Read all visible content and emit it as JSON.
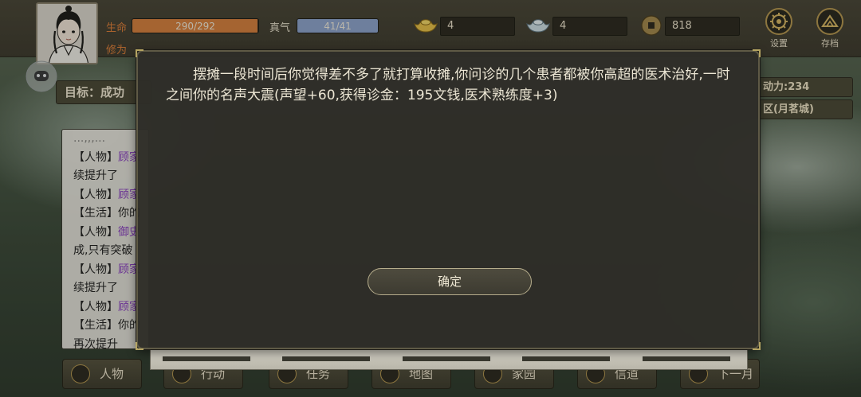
{
  "player": {
    "hp_label": "生命",
    "hp_value": "290/292",
    "hp_ratio": 0.993,
    "qi_label": "真气",
    "qi_value": "41/41",
    "qi_ratio": 1.0,
    "cultivation_label": "修为"
  },
  "currency": [
    {
      "icon": "gold-ingot-icon",
      "value": "4"
    },
    {
      "icon": "silver-ingot-icon",
      "value": "4"
    },
    {
      "icon": "copper-coin-icon",
      "value": "818"
    }
  ],
  "top_buttons": {
    "settings": "设置",
    "save": "存档"
  },
  "goal": {
    "text": "目标：成功"
  },
  "right_info": {
    "energy": "动力:234",
    "location": "区(月茗城)"
  },
  "log": [
    {
      "tag": "",
      "name": "",
      "rest": "...,,,..."
    },
    {
      "tag": "【人物】",
      "name": "顾家",
      "rest": ""
    },
    {
      "tag": "",
      "name": "",
      "rest": "续提升了"
    },
    {
      "tag": "【人物】",
      "name": "顾家",
      "rest": ""
    },
    {
      "tag": "【生活】",
      "name": "",
      "rest": "你的"
    },
    {
      "tag": "【人物】",
      "name": "御史",
      "rest": ""
    },
    {
      "tag": "",
      "name": "",
      "rest": "成,只有突破"
    },
    {
      "tag": "【人物】",
      "name": "顾家",
      "rest": ""
    },
    {
      "tag": "",
      "name": "",
      "rest": "续提升了"
    },
    {
      "tag": "【人物】",
      "name": "顾家",
      "rest": ""
    },
    {
      "tag": "【生活】",
      "name": "",
      "rest": "你的"
    },
    {
      "tag": "",
      "name": "",
      "rest": "再次提升"
    }
  ],
  "bottom_nav": [
    {
      "label": "人物",
      "icon": "person-icon"
    },
    {
      "label": "行动",
      "icon": "action-icon"
    },
    {
      "label": "任务",
      "icon": "quest-icon"
    },
    {
      "label": "地图",
      "icon": "map-icon"
    },
    {
      "label": "家园",
      "icon": "home-icon"
    },
    {
      "label": "信道",
      "icon": "path-icon"
    },
    {
      "label": "下一月",
      "icon": "moon-icon"
    }
  ],
  "dialog": {
    "message": "摆摊一段时间后你觉得差不多了就打算收摊,你问诊的几个患者都被你高超的医术治好,一时之间你的名声大震(声望+60,获得诊金：195文钱,医术熟练度+3)",
    "confirm": "确定"
  },
  "colors": {
    "hp": "#d9823f",
    "qi": "#8fa6cf",
    "accent": "#b89a52",
    "purple_name": "#8a3fc2"
  }
}
